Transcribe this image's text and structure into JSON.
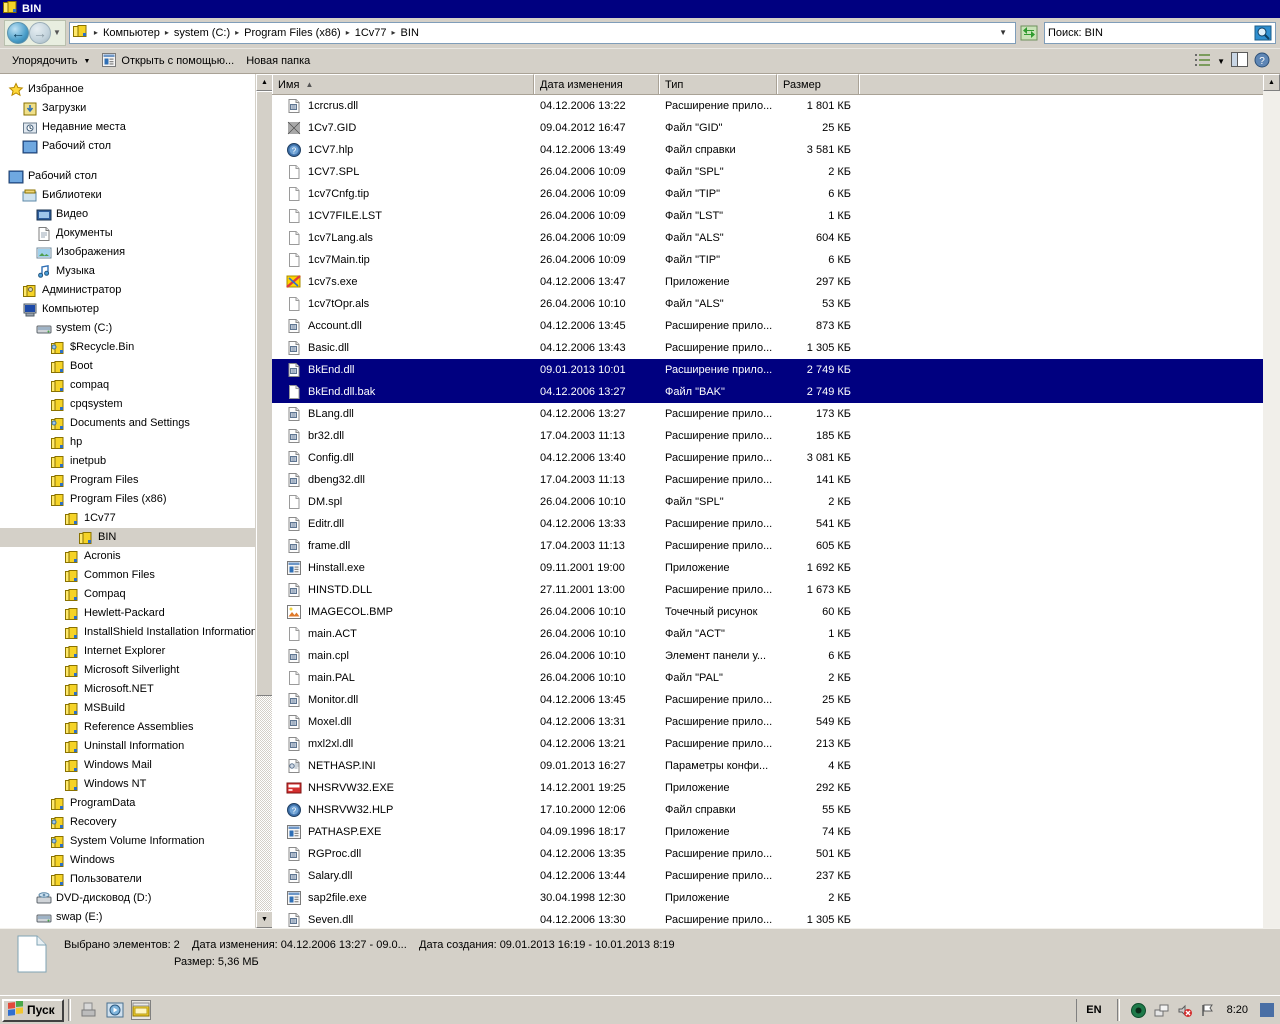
{
  "window": {
    "title": "BIN",
    "title_icon": "folder-icon"
  },
  "address_bar": {
    "back_icon": "back-arrow-icon",
    "forward_icon": "forward-arrow-icon",
    "history_caret_icon": "chevron-down-icon",
    "folder_icon": "folder-icon",
    "breadcrumbs": [
      "Компьютер",
      "system (C:)",
      "Program Files (x86)",
      "1Cv77",
      "BIN"
    ],
    "separator": "▸",
    "dropdown_caret": "▼",
    "refresh_icon": "refresh-icon",
    "search_value": "Поиск: BIN",
    "search_placeholder": "Поиск: BIN",
    "search_icon": "search-icon"
  },
  "toolbar": {
    "organize_label": "Упорядочить",
    "organize_caret": "▼",
    "open_with_label": "Открыть с помощью...",
    "open_with_icon": "open-with-icon",
    "new_folder_label": "Новая папка",
    "view_icon": "view-list-icon",
    "view_caret": "▼",
    "preview_pane_icon": "preview-pane-icon",
    "help_icon": "help-icon"
  },
  "sidebar": {
    "groups": [
      {
        "items": [
          {
            "label": "Избранное",
            "icon": "star-icon",
            "indent": 0,
            "selected": false
          },
          {
            "label": "Загрузки",
            "icon": "downloads-icon",
            "indent": 1,
            "selected": false
          },
          {
            "label": "Недавние места",
            "icon": "recent-places-icon",
            "indent": 1,
            "selected": false
          },
          {
            "label": "Рабочий стол",
            "icon": "desktop-icon",
            "indent": 1,
            "selected": false
          }
        ]
      },
      {
        "items": [
          {
            "label": "Рабочий стол",
            "icon": "desktop-icon",
            "indent": 0,
            "selected": false
          },
          {
            "label": "Библиотеки",
            "icon": "libraries-icon",
            "indent": 1,
            "selected": false
          },
          {
            "label": "Видео",
            "icon": "video-icon",
            "indent": 2,
            "selected": false
          },
          {
            "label": "Документы",
            "icon": "documents-icon",
            "indent": 2,
            "selected": false
          },
          {
            "label": "Изображения",
            "icon": "pictures-icon",
            "indent": 2,
            "selected": false
          },
          {
            "label": "Музыка",
            "icon": "music-icon",
            "indent": 2,
            "selected": false
          },
          {
            "label": "Администратор",
            "icon": "user-icon",
            "indent": 1,
            "selected": false
          },
          {
            "label": "Компьютер",
            "icon": "computer-icon",
            "indent": 1,
            "selected": false
          },
          {
            "label": "system (C:)",
            "icon": "harddisk-icon",
            "indent": 2,
            "selected": false
          },
          {
            "label": "$Recycle.Bin",
            "icon": "folder-shared-icon",
            "indent": 3,
            "selected": false
          },
          {
            "label": "Boot",
            "icon": "folder-icon",
            "indent": 3,
            "selected": false
          },
          {
            "label": "compaq",
            "icon": "folder-icon",
            "indent": 3,
            "selected": false
          },
          {
            "label": "cpqsystem",
            "icon": "folder-icon",
            "indent": 3,
            "selected": false
          },
          {
            "label": "Documents and Settings",
            "icon": "folder-shared-icon",
            "indent": 3,
            "selected": false
          },
          {
            "label": "hp",
            "icon": "folder-icon",
            "indent": 3,
            "selected": false
          },
          {
            "label": "inetpub",
            "icon": "folder-icon",
            "indent": 3,
            "selected": false
          },
          {
            "label": "Program Files",
            "icon": "folder-icon",
            "indent": 3,
            "selected": false
          },
          {
            "label": "Program Files (x86)",
            "icon": "folder-icon",
            "indent": 3,
            "selected": false
          },
          {
            "label": "1Cv77",
            "icon": "folder-icon",
            "indent": 4,
            "selected": false
          },
          {
            "label": "BIN",
            "icon": "folder-icon",
            "indent": 5,
            "selected": true
          },
          {
            "label": "Acronis",
            "icon": "folder-icon",
            "indent": 4,
            "selected": false
          },
          {
            "label": "Common Files",
            "icon": "folder-icon",
            "indent": 4,
            "selected": false
          },
          {
            "label": "Compaq",
            "icon": "folder-icon",
            "indent": 4,
            "selected": false
          },
          {
            "label": "Hewlett-Packard",
            "icon": "folder-icon",
            "indent": 4,
            "selected": false
          },
          {
            "label": "InstallShield Installation Information",
            "icon": "folder-icon",
            "indent": 4,
            "selected": false
          },
          {
            "label": "Internet Explorer",
            "icon": "folder-icon",
            "indent": 4,
            "selected": false
          },
          {
            "label": "Microsoft Silverlight",
            "icon": "folder-icon",
            "indent": 4,
            "selected": false
          },
          {
            "label": "Microsoft.NET",
            "icon": "folder-icon",
            "indent": 4,
            "selected": false
          },
          {
            "label": "MSBuild",
            "icon": "folder-icon",
            "indent": 4,
            "selected": false
          },
          {
            "label": "Reference Assemblies",
            "icon": "folder-icon",
            "indent": 4,
            "selected": false
          },
          {
            "label": "Uninstall Information",
            "icon": "folder-icon",
            "indent": 4,
            "selected": false
          },
          {
            "label": "Windows Mail",
            "icon": "folder-icon",
            "indent": 4,
            "selected": false
          },
          {
            "label": "Windows NT",
            "icon": "folder-icon",
            "indent": 4,
            "selected": false
          },
          {
            "label": "ProgramData",
            "icon": "folder-icon",
            "indent": 3,
            "selected": false
          },
          {
            "label": "Recovery",
            "icon": "folder-shared-icon",
            "indent": 3,
            "selected": false
          },
          {
            "label": "System Volume Information",
            "icon": "folder-shared-icon",
            "indent": 3,
            "selected": false
          },
          {
            "label": "Windows",
            "icon": "folder-icon",
            "indent": 3,
            "selected": false
          },
          {
            "label": "Пользователи",
            "icon": "folder-icon",
            "indent": 3,
            "selected": false
          },
          {
            "label": "DVD-дисковод (D:)",
            "icon": "dvd-drive-icon",
            "indent": 2,
            "selected": false
          },
          {
            "label": "swap (E:)",
            "icon": "harddisk-icon",
            "indent": 2,
            "selected": false
          }
        ]
      }
    ],
    "scroll_up_icon": "▲",
    "scroll_down_icon": "▼"
  },
  "file_list": {
    "columns": [
      {
        "key": "name",
        "label": "Имя",
        "sorted": "asc",
        "sort_icon": "▲"
      },
      {
        "key": "date",
        "label": "Дата изменения",
        "sorted": "",
        "sort_icon": ""
      },
      {
        "key": "type",
        "label": "Тип",
        "sorted": "",
        "sort_icon": ""
      },
      {
        "key": "size",
        "label": "Размер",
        "sorted": "",
        "sort_icon": ""
      }
    ],
    "rows": [
      {
        "name": "1crcrus.dll",
        "date": "04.12.2006 13:22",
        "type": "Расширение прило...",
        "size": "1 801 КБ",
        "icon": "dll-icon",
        "selected": false
      },
      {
        "name": "1Cv7.GID",
        "date": "09.04.2012 16:47",
        "type": "Файл \"GID\"",
        "size": "25 КБ",
        "icon": "gid-file-icon",
        "selected": false
      },
      {
        "name": "1CV7.hlp",
        "date": "04.12.2006 13:49",
        "type": "Файл справки",
        "size": "3 581 КБ",
        "icon": "help-file-icon",
        "selected": false
      },
      {
        "name": "1CV7.SPL",
        "date": "26.04.2006 10:09",
        "type": "Файл \"SPL\"",
        "size": "2 КБ",
        "icon": "blank-file-icon",
        "selected": false
      },
      {
        "name": "1cv7Cnfg.tip",
        "date": "26.04.2006 10:09",
        "type": "Файл \"TIP\"",
        "size": "6 КБ",
        "icon": "blank-file-icon",
        "selected": false
      },
      {
        "name": "1CV7FILE.LST",
        "date": "26.04.2006 10:09",
        "type": "Файл \"LST\"",
        "size": "1 КБ",
        "icon": "blank-file-icon",
        "selected": false
      },
      {
        "name": "1cv7Lang.als",
        "date": "26.04.2006 10:09",
        "type": "Файл \"ALS\"",
        "size": "604 КБ",
        "icon": "blank-file-icon",
        "selected": false
      },
      {
        "name": "1cv7Main.tip",
        "date": "26.04.2006 10:09",
        "type": "Файл \"TIP\"",
        "size": "6 КБ",
        "icon": "blank-file-icon",
        "selected": false
      },
      {
        "name": "1cv7s.exe",
        "date": "04.12.2006 13:47",
        "type": "Приложение",
        "size": "297 КБ",
        "icon": "1c-app-icon",
        "selected": false
      },
      {
        "name": "1cv7tOpr.als",
        "date": "26.04.2006 10:10",
        "type": "Файл \"ALS\"",
        "size": "53 КБ",
        "icon": "blank-file-icon",
        "selected": false
      },
      {
        "name": "Account.dll",
        "date": "04.12.2006 13:45",
        "type": "Расширение прило...",
        "size": "873 КБ",
        "icon": "dll-icon",
        "selected": false
      },
      {
        "name": "Basic.dll",
        "date": "04.12.2006 13:43",
        "type": "Расширение прило...",
        "size": "1 305 КБ",
        "icon": "dll-icon",
        "selected": false
      },
      {
        "name": "BkEnd.dll",
        "date": "09.01.2013 10:01",
        "type": "Расширение прило...",
        "size": "2 749 КБ",
        "icon": "dll-icon",
        "selected": true
      },
      {
        "name": "BkEnd.dll.bak",
        "date": "04.12.2006 13:27",
        "type": "Файл \"BAK\"",
        "size": "2 749 КБ",
        "icon": "blank-file-icon",
        "selected": true
      },
      {
        "name": "BLang.dll",
        "date": "04.12.2006 13:27",
        "type": "Расширение прило...",
        "size": "173 КБ",
        "icon": "dll-icon",
        "selected": false
      },
      {
        "name": "br32.dll",
        "date": "17.04.2003 11:13",
        "type": "Расширение прило...",
        "size": "185 КБ",
        "icon": "dll-icon",
        "selected": false
      },
      {
        "name": "Config.dll",
        "date": "04.12.2006 13:40",
        "type": "Расширение прило...",
        "size": "3 081 КБ",
        "icon": "dll-icon",
        "selected": false
      },
      {
        "name": "dbeng32.dll",
        "date": "17.04.2003 11:13",
        "type": "Расширение прило...",
        "size": "141 КБ",
        "icon": "dll-icon",
        "selected": false
      },
      {
        "name": "DM.spl",
        "date": "26.04.2006 10:10",
        "type": "Файл \"SPL\"",
        "size": "2 КБ",
        "icon": "blank-file-icon",
        "selected": false
      },
      {
        "name": "Editr.dll",
        "date": "04.12.2006 13:33",
        "type": "Расширение прило...",
        "size": "541 КБ",
        "icon": "dll-icon",
        "selected": false
      },
      {
        "name": "frame.dll",
        "date": "17.04.2003 11:13",
        "type": "Расширение прило...",
        "size": "605 КБ",
        "icon": "dll-icon",
        "selected": false
      },
      {
        "name": "Hinstall.exe",
        "date": "09.11.2001 19:00",
        "type": "Приложение",
        "size": "1 692 КБ",
        "icon": "exe-icon",
        "selected": false
      },
      {
        "name": "HINSTD.DLL",
        "date": "27.11.2001 13:00",
        "type": "Расширение прило...",
        "size": "1 673 КБ",
        "icon": "dll-icon",
        "selected": false
      },
      {
        "name": "IMAGECOL.BMP",
        "date": "26.04.2006 10:10",
        "type": "Точечный рисунок",
        "size": "60 КБ",
        "icon": "bitmap-icon",
        "selected": false
      },
      {
        "name": "main.ACT",
        "date": "26.04.2006 10:10",
        "type": "Файл \"ACT\"",
        "size": "1 КБ",
        "icon": "blank-file-icon",
        "selected": false
      },
      {
        "name": "main.cpl",
        "date": "26.04.2006 10:10",
        "type": "Элемент панели у...",
        "size": "6 КБ",
        "icon": "dll-icon",
        "selected": false
      },
      {
        "name": "main.PAL",
        "date": "26.04.2006 10:10",
        "type": "Файл \"PAL\"",
        "size": "2 КБ",
        "icon": "blank-file-icon",
        "selected": false
      },
      {
        "name": "Monitor.dll",
        "date": "04.12.2006 13:45",
        "type": "Расширение прило...",
        "size": "25 КБ",
        "icon": "dll-icon",
        "selected": false
      },
      {
        "name": "Moxel.dll",
        "date": "04.12.2006 13:31",
        "type": "Расширение прило...",
        "size": "549 КБ",
        "icon": "dll-icon",
        "selected": false
      },
      {
        "name": "mxl2xl.dll",
        "date": "04.12.2006 13:21",
        "type": "Расширение прило...",
        "size": "213 КБ",
        "icon": "dll-icon",
        "selected": false
      },
      {
        "name": "NETHASP.INI",
        "date": "09.01.2013 16:27",
        "type": "Параметры конфи...",
        "size": "4 КБ",
        "icon": "ini-icon",
        "selected": false
      },
      {
        "name": "NHSRVW32.EXE",
        "date": "14.12.2001 19:25",
        "type": "Приложение",
        "size": "292 КБ",
        "icon": "red-app-icon",
        "selected": false
      },
      {
        "name": "NHSRVW32.HLP",
        "date": "17.10.2000 12:06",
        "type": "Файл справки",
        "size": "55 КБ",
        "icon": "help-file-icon",
        "selected": false
      },
      {
        "name": "PATHASP.EXE",
        "date": "04.09.1996 18:17",
        "type": "Приложение",
        "size": "74 КБ",
        "icon": "exe-icon",
        "selected": false
      },
      {
        "name": "RGProc.dll",
        "date": "04.12.2006 13:35",
        "type": "Расширение прило...",
        "size": "501 КБ",
        "icon": "dll-icon",
        "selected": false
      },
      {
        "name": "Salary.dll",
        "date": "04.12.2006 13:44",
        "type": "Расширение прило...",
        "size": "237 КБ",
        "icon": "dll-icon",
        "selected": false
      },
      {
        "name": "sap2file.exe",
        "date": "30.04.1998 12:30",
        "type": "Приложение",
        "size": "2 КБ",
        "icon": "exe-icon",
        "selected": false
      },
      {
        "name": "Seven.dll",
        "date": "04.12.2006 13:30",
        "type": "Расширение прило...",
        "size": "1 305 КБ",
        "icon": "dll-icon",
        "selected": false
      }
    ]
  },
  "details_pane": {
    "icon": "file-preview-icon",
    "selected_count_label": "Выбрано элементов: 2",
    "modified_label": "Дата изменения: 04.12.2006 13:27 - 09.0...",
    "created_label": "Дата создания: 09.01.2013 16:19 - 10.01.2013 8:19",
    "size_label": "Размер: 5,36 МБ"
  },
  "taskbar": {
    "start_label": "Пуск",
    "start_icon": "windows-flag-icon",
    "quicklaunch": [
      {
        "icon": "show-desktop-icon",
        "active": false
      },
      {
        "icon": "media-player-icon",
        "active": false
      },
      {
        "icon": "explorer-window-icon",
        "active": true
      }
    ],
    "tray": {
      "language": "EN",
      "icons": [
        "record-icon",
        "network-icon",
        "volume-muted-icon",
        "flag-icon"
      ],
      "clock": "8:20",
      "desktop_icon": "show-desktop-tray-icon"
    }
  },
  "colors": {
    "titlebar_bg": "#000080",
    "selection_bg": "#000080",
    "chrome_bg": "#d4d0c8",
    "list_bg": "#ffffff",
    "tree_selected_bg": "#d4d0c8"
  }
}
